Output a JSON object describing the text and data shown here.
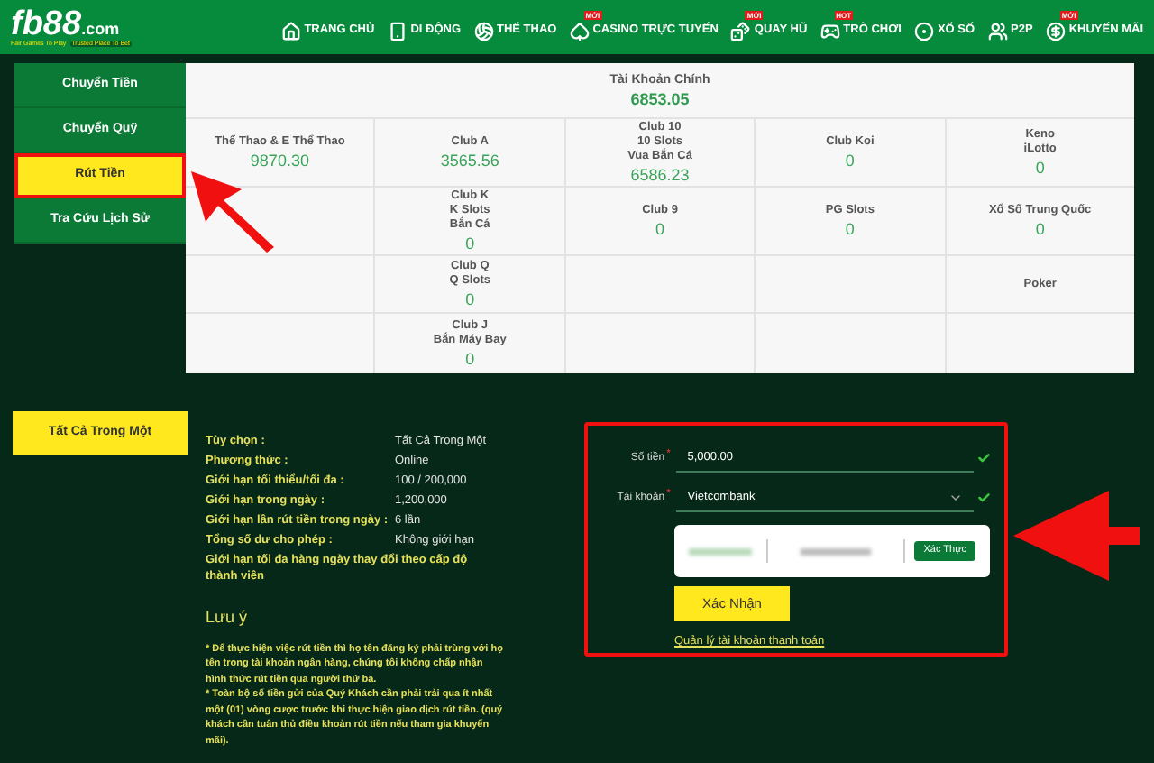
{
  "logo": {
    "brand": "fb88",
    "suffix": ".com",
    "tagline_left": "Fair Games To Play",
    "tagline_right": "Trusted Place To Bet"
  },
  "nav": [
    {
      "label": "TRANG CHỦ"
    },
    {
      "label": "DI ĐỘNG"
    },
    {
      "label": "THỂ THAO"
    },
    {
      "label": "CASINO TRỰC TUYẾN",
      "badge": "MỚI"
    },
    {
      "label": "QUAY HŨ",
      "badge": "MỚI"
    },
    {
      "label": "TRÒ CHƠI",
      "badge": "HOT"
    },
    {
      "label": "XỔ SỐ"
    },
    {
      "label": "P2P"
    },
    {
      "label": "KHUYẾN MÃI",
      "badge": "MỚI"
    }
  ],
  "sidebar": [
    {
      "label": "Chuyển Tiền",
      "selected": false
    },
    {
      "label": "Chuyển Quỹ",
      "selected": false
    },
    {
      "label": "Rút Tiền",
      "selected": true
    },
    {
      "label": "Tra Cứu Lịch Sử",
      "selected": false
    }
  ],
  "balances": {
    "main": {
      "lines": [
        "Tài Khoản Chính"
      ],
      "value": "6853.05"
    },
    "rows": [
      [
        {
          "lines": [
            "Thể Thao & E Thể Thao"
          ],
          "value": "9870.30"
        },
        {
          "lines": [
            "Club A"
          ],
          "value": "3565.56"
        },
        {
          "lines": [
            "Club 10",
            "10 Slots",
            "Vua Bắn Cá"
          ],
          "value": "6586.23"
        },
        {
          "lines": [
            "Club Koi"
          ],
          "value": "0"
        },
        {
          "lines": [
            "Keno",
            "iLotto"
          ],
          "value": "0"
        }
      ],
      [
        {},
        {
          "lines": [
            "Club K",
            "K Slots",
            "Bắn Cá"
          ],
          "value": "0"
        },
        {
          "lines": [
            "Club 9"
          ],
          "value": "0"
        },
        {
          "lines": [
            "PG Slots"
          ],
          "value": "0"
        },
        {
          "lines": [
            "Xổ Số Trung Quốc"
          ],
          "value": "0"
        }
      ],
      [
        {},
        {
          "lines": [
            "Club Q",
            "Q Slots"
          ],
          "value": "0"
        },
        {},
        {},
        {
          "lines": [
            "Poker"
          ]
        }
      ],
      [
        {},
        {
          "lines": [
            "Club J",
            "Bắn Máy Bay"
          ],
          "value": "0"
        },
        {},
        {},
        {}
      ]
    ]
  },
  "method_tabs": [
    {
      "label": "Tất Cả Trong Một",
      "selected": true
    }
  ],
  "details": [
    {
      "label": "Tùy chọn :",
      "value": "Tất Cả Trong Một"
    },
    {
      "label": "Phương thức :",
      "value": "Online"
    },
    {
      "label": "Giới hạn tối thiểu/tối đa :",
      "value": "100 / 200,000"
    },
    {
      "label": "Giới hạn trong ngày :",
      "value": "1,200,000"
    },
    {
      "label": "Giới hạn lần rút tiền trong ngày :",
      "value": "6 lần"
    },
    {
      "label": "Tổng số dư cho phép :",
      "value": "Không giới hạn"
    }
  ],
  "detail_note": "Giới hạn tối đa hàng ngày thay đổi theo cấp độ thành viên",
  "notes": {
    "title": "Lưu ý",
    "items": [
      "* Để thực hiện việc rút tiền thì họ tên đăng ký phải trùng với họ tên trong tài khoản ngân hàng, chúng tôi không chấp nhận hình thức rút tiền qua người thứ ba.",
      "* Toàn bộ số tiền gửi của Quý Khách cần phải trải qua ít nhất một (01) vòng cược trước khi thực hiện giao dịch rút tiền. (quý khách cần tuân thủ điều khoản rút tiền nếu tham gia khuyến mãi)."
    ]
  },
  "form": {
    "amount": {
      "label": "Số tiền",
      "required": "*",
      "value": "5,000.00",
      "valid": true
    },
    "account": {
      "label": "Tài khoản",
      "required": "*",
      "value": "Vietcombank",
      "valid": true
    },
    "verify_button": "Xác Thực",
    "submit_button": "Xác Nhận",
    "manage_link": "Quản lý tài khoản thanh toán"
  },
  "annotations": {
    "highlight_selected": true,
    "arrows": true
  }
}
